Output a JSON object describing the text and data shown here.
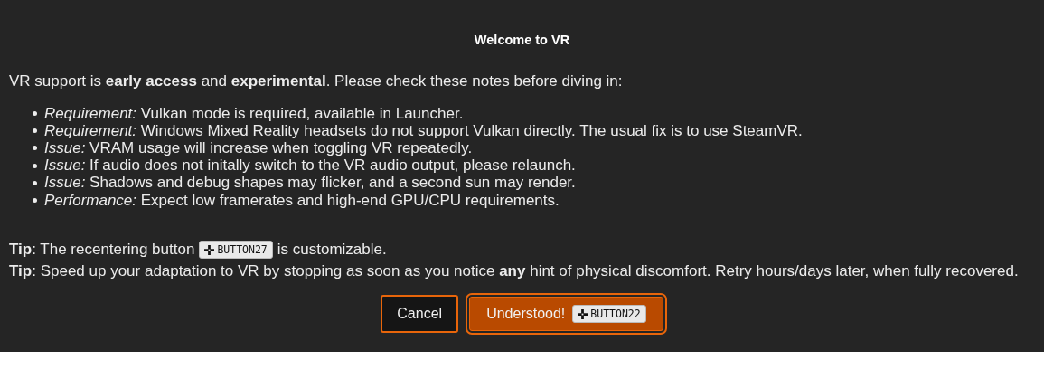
{
  "dialog": {
    "title": "Welcome to VR",
    "intro": "VR support is **early access** and **experimental**. Please check these notes before diving in:",
    "notes": [
      {
        "label": "Requirement:",
        "text": "Vulkan mode is required, available in Launcher."
      },
      {
        "label": "Requirement:",
        "text": "Windows Mixed Reality headsets do not support Vulkan directly. The usual fix is to use SteamVR."
      },
      {
        "label": "Issue:",
        "text": "VRAM usage will increase when toggling VR repeatedly."
      },
      {
        "label": "Issue:",
        "text": "If audio does not initally switch to the VR audio output, please relaunch."
      },
      {
        "label": "Issue:",
        "text": "Shadows and debug shapes may flicker, and a second sun may render."
      },
      {
        "label": "Performance:",
        "text": "Expect low framerates and high-end GPU/CPU requirements."
      }
    ],
    "tips": [
      [
        {
          "kind": "text",
          "text": "**Tip**: The recentering button"
        },
        {
          "kind": "key",
          "text": "BUTTON27"
        },
        {
          "kind": "text",
          "text": "is customizable."
        }
      ],
      [
        {
          "kind": "text",
          "text": "**Tip**: Speed up your adaptation to VR by stopping as soon as you notice **any** hint of physical discomfort. Retry hours/days later, when fully recovered."
        }
      ]
    ],
    "buttons": [
      {
        "label": "Cancel",
        "kind": "secondary"
      },
      {
        "label": "Understood!",
        "kind": "primary",
        "key": "BUTTON22"
      }
    ]
  }
}
